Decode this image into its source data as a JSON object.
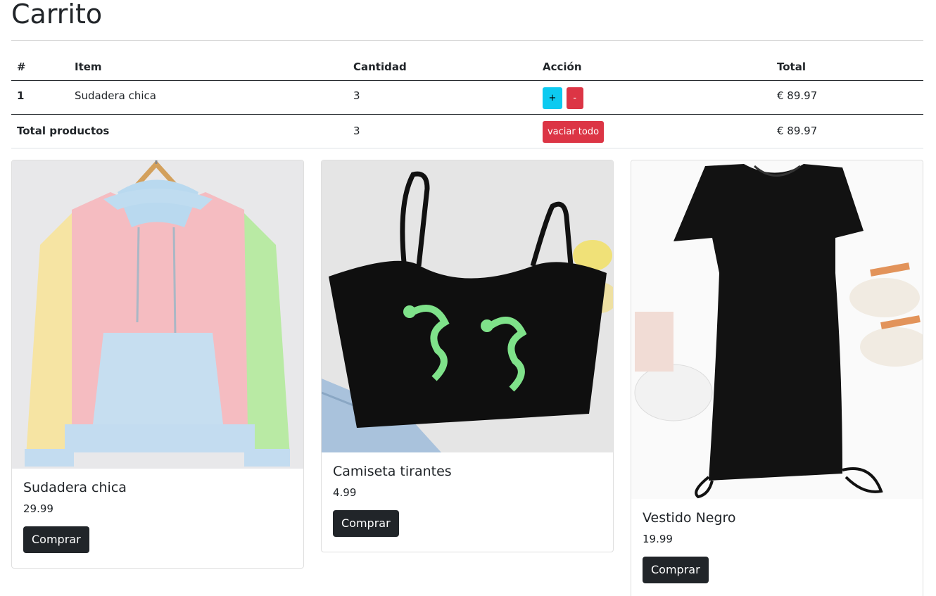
{
  "page": {
    "title": "Carrito"
  },
  "cart": {
    "headers": {
      "num": "#",
      "item": "Item",
      "qty": "Cantidad",
      "action": "Acción",
      "total": "Total"
    },
    "rows": [
      {
        "num": "1",
        "item": "Sudadera chica",
        "qty": "3",
        "plus": "+",
        "minus": "-",
        "total": "€ 89.97"
      }
    ],
    "summary": {
      "label": "Total productos",
      "qty": "3",
      "clear_label": "vaciar todo",
      "total": "€ 89.97"
    }
  },
  "products": [
    {
      "name": "Sudadera chica",
      "price": "29.99",
      "button": "Comprar",
      "image": "pastel colorblock hoodie"
    },
    {
      "name": "Camiseta tirantes",
      "price": "4.99",
      "button": "Comprar",
      "image": "black cami top with green dragon print"
    },
    {
      "name": "Vestido Negro",
      "price": "19.99",
      "button": "Comprar",
      "image": "black ruched bodycon t-shirt dress"
    }
  ],
  "colors": {
    "info": "#0dcaf0",
    "danger": "#dc3545",
    "dark": "#212529"
  }
}
